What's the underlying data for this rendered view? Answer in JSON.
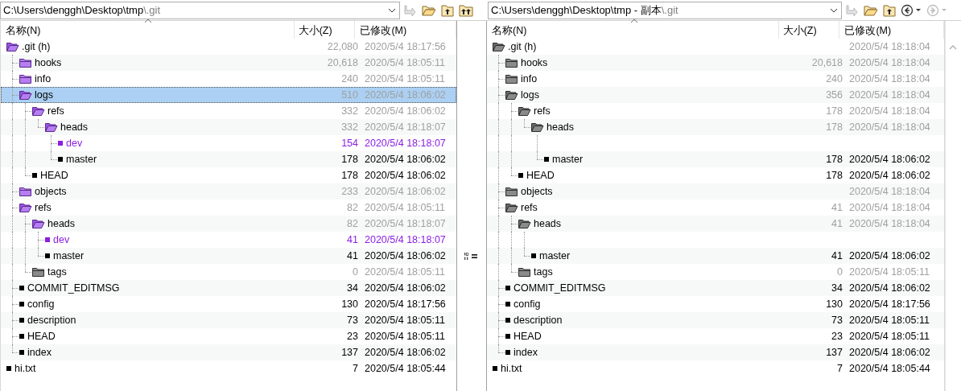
{
  "panes": [
    {
      "path": "C:\\Users\\denggh\\Desktop\\tmp",
      "path_suffix": "\\.git",
      "columns": [
        "名称(N)",
        "大小(Z)",
        "已修改(M)"
      ],
      "rows": [
        {
          "kind": "folder",
          "name": ".git (h)",
          "differs": true,
          "expanded": true,
          "selected": false,
          "size": "22,080",
          "modified": "2020/5/4 18:17:56",
          "children": [
            {
              "kind": "folder",
              "name": "hooks",
              "differs": true,
              "expanded": false,
              "selected": false,
              "size": "20,618",
              "modified": "2020/5/4 18:05:11"
            },
            {
              "kind": "folder",
              "name": "info",
              "differs": true,
              "expanded": false,
              "selected": false,
              "size": "240",
              "modified": "2020/5/4 18:05:11"
            },
            {
              "kind": "folder",
              "name": "logs",
              "differs": true,
              "expanded": true,
              "selected": true,
              "size": "510",
              "modified": "2020/5/4 18:06:02",
              "children": [
                {
                  "kind": "folder",
                  "name": "refs",
                  "differs": true,
                  "expanded": true,
                  "selected": false,
                  "size": "332",
                  "modified": "2020/5/4 18:06:02",
                  "children": [
                    {
                      "kind": "folder",
                      "name": "heads",
                      "differs": true,
                      "expanded": true,
                      "selected": false,
                      "size": "332",
                      "modified": "2020/5/4 18:18:07",
                      "children": [
                        {
                          "kind": "file",
                          "name": "dev",
                          "newer": true,
                          "selected": false,
                          "size": "154",
                          "modified": "2020/5/4 18:18:07"
                        },
                        {
                          "kind": "file",
                          "name": "master",
                          "newer": false,
                          "selected": false,
                          "size": "178",
                          "modified": "2020/5/4 18:06:02"
                        }
                      ]
                    }
                  ]
                },
                {
                  "kind": "file",
                  "name": "HEAD",
                  "newer": false,
                  "selected": false,
                  "size": "178",
                  "modified": "2020/5/4 18:06:02"
                }
              ]
            },
            {
              "kind": "folder",
              "name": "objects",
              "differs": true,
              "expanded": false,
              "selected": false,
              "size": "233",
              "modified": "2020/5/4 18:06:02"
            },
            {
              "kind": "folder",
              "name": "refs",
              "differs": true,
              "expanded": true,
              "selected": false,
              "size": "82",
              "modified": "2020/5/4 18:05:11",
              "children": [
                {
                  "kind": "folder",
                  "name": "heads",
                  "differs": true,
                  "expanded": true,
                  "selected": false,
                  "size": "82",
                  "modified": "2020/5/4 18:18:07",
                  "children": [
                    {
                      "kind": "file",
                      "name": "dev",
                      "newer": true,
                      "selected": false,
                      "size": "41",
                      "modified": "2020/5/4 18:18:07"
                    },
                    {
                      "kind": "file",
                      "name": "master",
                      "newer": false,
                      "selected": false,
                      "compare_mark": true,
                      "size": "41",
                      "modified": "2020/5/4 18:06:02"
                    }
                  ]
                },
                {
                  "kind": "folder",
                  "name": "tags",
                  "differs": false,
                  "expanded": false,
                  "selected": false,
                  "size": "0",
                  "modified": "2020/5/4 18:05:11"
                }
              ]
            },
            {
              "kind": "file",
              "name": "COMMIT_EDITMSG",
              "newer": false,
              "selected": false,
              "size": "34",
              "modified": "2020/5/4 18:06:02"
            },
            {
              "kind": "file",
              "name": "config",
              "newer": false,
              "selected": false,
              "size": "130",
              "modified": "2020/5/4 18:17:56"
            },
            {
              "kind": "file",
              "name": "description",
              "newer": false,
              "selected": false,
              "size": "73",
              "modified": "2020/5/4 18:05:11"
            },
            {
              "kind": "file",
              "name": "HEAD",
              "newer": false,
              "selected": false,
              "size": "23",
              "modified": "2020/5/4 18:05:11"
            },
            {
              "kind": "file",
              "name": "index",
              "newer": false,
              "selected": false,
              "size": "137",
              "modified": "2020/5/4 18:06:02"
            }
          ]
        },
        {
          "kind": "file",
          "name": "hi.txt",
          "newer": false,
          "selected": false,
          "size": "7",
          "modified": "2020/5/4 18:05:44"
        }
      ]
    },
    {
      "path": "C:\\Users\\denggh\\Desktop\\tmp - 副本",
      "path_suffix": "\\.git",
      "columns": [
        "名称(N)",
        "大小(Z)",
        "已修改(M)"
      ],
      "rows": [
        {
          "kind": "folder",
          "name": ".git (h)",
          "differs": false,
          "expanded": true,
          "selected": false,
          "modified": "2020/5/4 18:18:04",
          "children": [
            {
              "kind": "folder",
              "name": "hooks",
              "differs": false,
              "expanded": false,
              "selected": false,
              "size": "20,618",
              "modified": "2020/5/4 18:18:04"
            },
            {
              "kind": "folder",
              "name": "info",
              "differs": false,
              "expanded": false,
              "selected": false,
              "size": "240",
              "modified": "2020/5/4 18:18:04"
            },
            {
              "kind": "folder",
              "name": "logs",
              "differs": false,
              "expanded": true,
              "selected": false,
              "size": "356",
              "modified": "2020/5/4 18:18:04",
              "children": [
                {
                  "kind": "folder",
                  "name": "refs",
                  "differs": false,
                  "expanded": true,
                  "selected": false,
                  "size": "178",
                  "modified": "2020/5/4 18:18:04",
                  "children": [
                    {
                      "kind": "folder",
                      "name": "heads",
                      "differs": false,
                      "expanded": true,
                      "selected": false,
                      "size": "178",
                      "modified": "2020/5/4 18:18:04",
                      "children": [
                        {
                          "kind": "blank",
                          "selected": false
                        },
                        {
                          "kind": "file",
                          "name": "master",
                          "newer": false,
                          "selected": false,
                          "size": "178",
                          "modified": "2020/5/4 18:06:02"
                        }
                      ]
                    }
                  ]
                },
                {
                  "kind": "file",
                  "name": "HEAD",
                  "newer": false,
                  "selected": false,
                  "size": "178",
                  "modified": "2020/5/4 18:06:02"
                }
              ]
            },
            {
              "kind": "folder",
              "name": "objects",
              "differs": false,
              "expanded": false,
              "selected": false,
              "modified": "2020/5/4 18:18:04"
            },
            {
              "kind": "folder",
              "name": "refs",
              "differs": false,
              "expanded": true,
              "selected": false,
              "size": "41",
              "modified": "2020/5/4 18:18:04",
              "children": [
                {
                  "kind": "folder",
                  "name": "heads",
                  "differs": false,
                  "expanded": true,
                  "selected": false,
                  "size": "41",
                  "modified": "2020/5/4 18:18:04",
                  "children": [
                    {
                      "kind": "blank",
                      "selected": false
                    },
                    {
                      "kind": "file",
                      "name": "master",
                      "newer": false,
                      "selected": false,
                      "size": "41",
                      "modified": "2020/5/4 18:06:02"
                    }
                  ]
                },
                {
                  "kind": "folder",
                  "name": "tags",
                  "differs": false,
                  "expanded": false,
                  "selected": false,
                  "size": "0",
                  "modified": "2020/5/4 18:05:11"
                }
              ]
            },
            {
              "kind": "file",
              "name": "COMMIT_EDITMSG",
              "newer": false,
              "selected": false,
              "size": "34",
              "modified": "2020/5/4 18:06:02"
            },
            {
              "kind": "file",
              "name": "config",
              "newer": false,
              "selected": false,
              "size": "130",
              "modified": "2020/5/4 18:17:56"
            },
            {
              "kind": "file",
              "name": "description",
              "newer": false,
              "selected": false,
              "size": "73",
              "modified": "2020/5/4 18:05:11"
            },
            {
              "kind": "file",
              "name": "HEAD",
              "newer": false,
              "selected": false,
              "size": "23",
              "modified": "2020/5/4 18:05:11"
            },
            {
              "kind": "file",
              "name": "index",
              "newer": false,
              "selected": false,
              "size": "137",
              "modified": "2020/5/4 18:06:02"
            }
          ]
        },
        {
          "kind": "file",
          "name": "hi.txt",
          "newer": false,
          "selected": false,
          "size": "7",
          "modified": "2020/5/4 18:05:44"
        }
      ]
    }
  ]
}
